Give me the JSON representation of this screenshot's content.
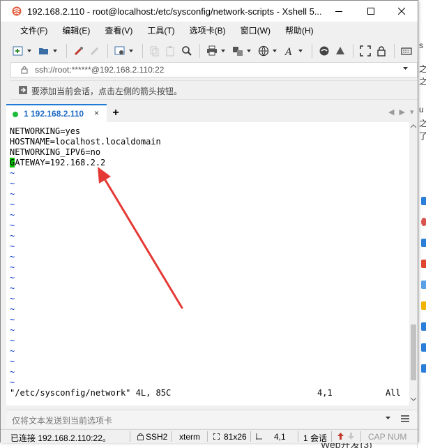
{
  "window": {
    "title": "192.168.2.110 - root@localhost:/etc/sysconfig/network-scripts - Xshell 5..."
  },
  "menu": [
    "文件(F)",
    "编辑(E)",
    "查看(V)",
    "工具(T)",
    "选项卡(B)",
    "窗口(W)",
    "帮助(H)"
  ],
  "address": {
    "text": "ssh://root:******@192.168.2.110:22"
  },
  "hint": {
    "text": "要添加当前会话，点击左侧的箭头按钮。"
  },
  "tab": {
    "label": "1 192.168.2.110",
    "close": "×",
    "add": "+",
    "nav_left": "◀",
    "nav_right": "▶",
    "nav_menu": "▾"
  },
  "terminal": {
    "lines": [
      "NETWORKING=yes",
      "HOSTNAME=localhost.localdomain",
      "NETWORKING_IPV6=no"
    ],
    "gateway_cursor": "G",
    "gateway_rest": "ATEWAY=192.168.2.2",
    "tilde": "~",
    "status_file": "\"/etc/sysconfig/network\" 4L, 85C",
    "status_pos": "4,1",
    "status_all": "All",
    "arrow_color": "#e53935",
    "cursor_color": "#00c000",
    "tilde_color": "#0033cc"
  },
  "sendbar": {
    "placeholder": "仅将文本发送到当前选项卡"
  },
  "statusbar": {
    "connection": "已连接 192.168.2.110:22。",
    "protocol": "SSH2",
    "terminal": "xterm",
    "size": "81x26",
    "position": "4,1",
    "sessions": "1 会话",
    "cap": "CAP",
    "num": "NUM"
  },
  "background": {
    "bottom_text": "Web开发(3)"
  }
}
